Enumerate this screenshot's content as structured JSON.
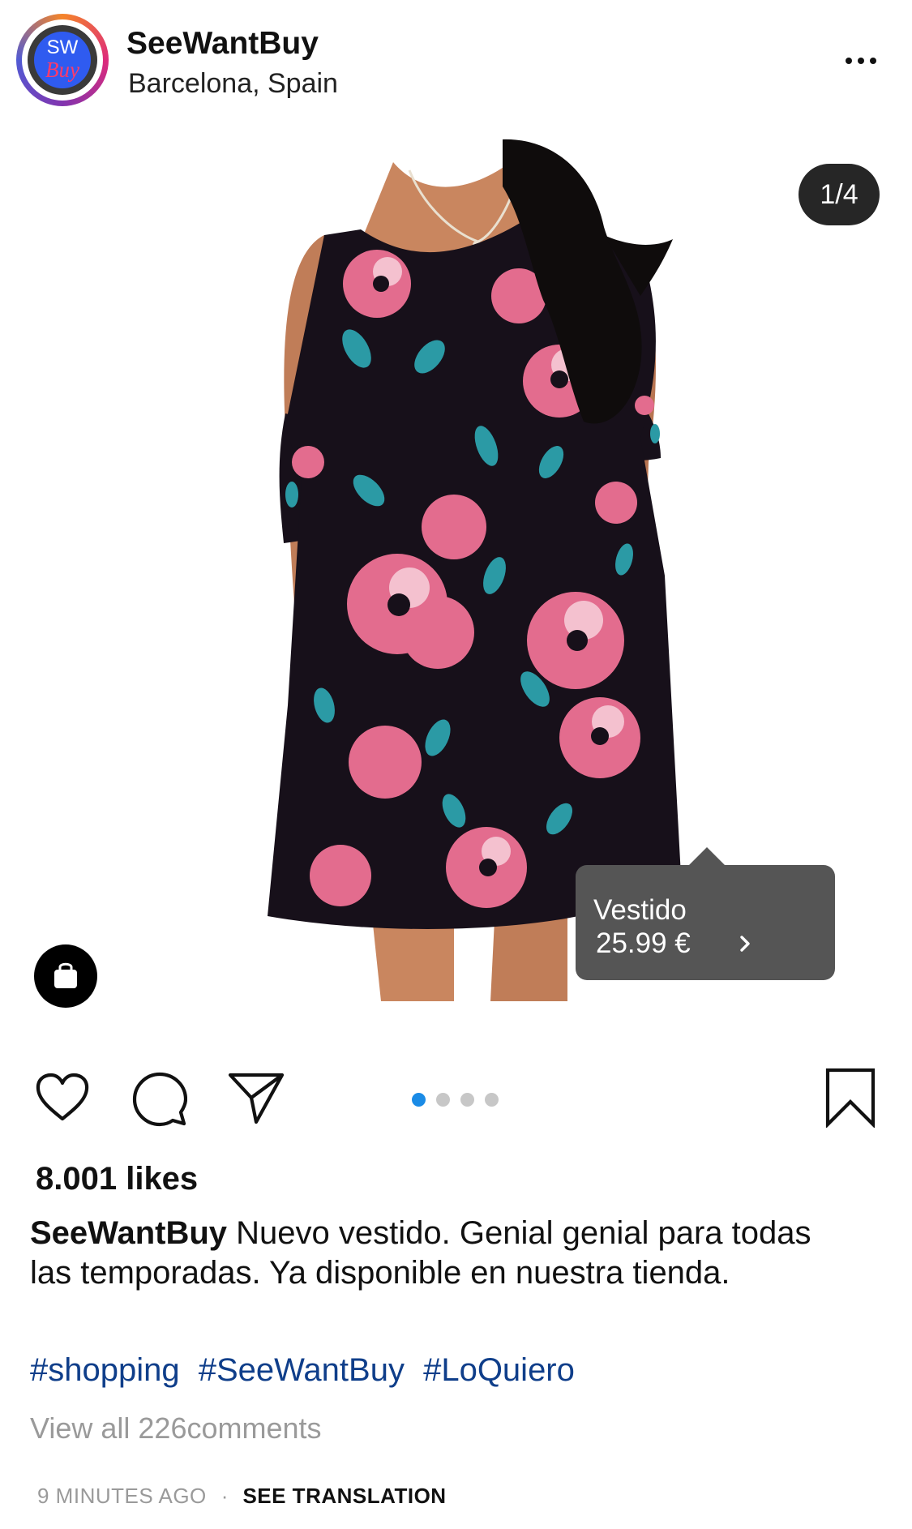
{
  "post": {
    "username": "SeeWantBuy",
    "location": "Barcelona, Spain",
    "avatar": {
      "line1": "SW",
      "line2": "Buy"
    },
    "more_icon": "more-horizontal-icon",
    "image_counter": "1/4",
    "image_description": "Black floral print cold-shoulder mini dress with pink roses and teal leaves",
    "product_tag": {
      "name": "Vestido",
      "price": "25.99 €",
      "icon": "chevron-right-icon"
    },
    "shop_icon": "shopping-bag-icon"
  },
  "actions": {
    "like_icon": "heart-icon",
    "comment_icon": "comment-icon",
    "share_icon": "send-icon",
    "save_icon": "bookmark-icon",
    "carousel": {
      "current": 1,
      "total": 4
    }
  },
  "stats": {
    "likes": "8.001 likes"
  },
  "caption": {
    "username": "SeeWantBuy",
    "text": "Nuevo vestido. Genial genial para todas las temporadas. Ya disponible en nuestra tienda.",
    "hashtags": [
      "#shopping",
      "#SeeWantBuy",
      "#LoQuiero"
    ]
  },
  "comments": {
    "view_all": "View all 226comments"
  },
  "footer": {
    "timestamp": "9 MINUTES AGO",
    "separator": "·",
    "translation": "SEE TRANSLATION"
  },
  "colors": {
    "hashtag": "#0f3e8a",
    "carousel_active": "#1a8be6",
    "carousel_inactive": "#c7c7c7",
    "tag_background": "#555555",
    "counter_background": "#262626",
    "dress": "#17101a",
    "rose": "#ea6b8f",
    "leaf": "#2b9aa5"
  }
}
